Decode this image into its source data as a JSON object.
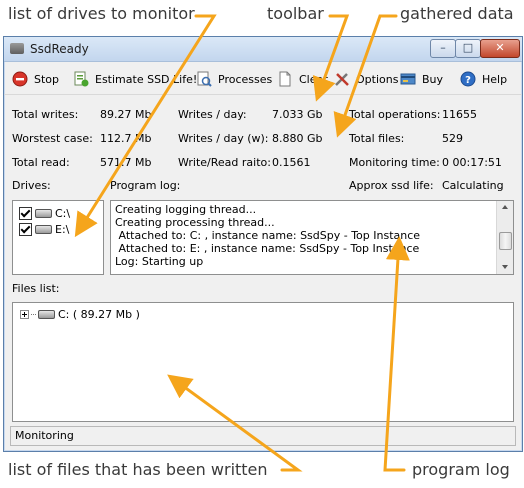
{
  "annotations": {
    "drives_monitor": "list of drives to monitor",
    "toolbar": "toolbar",
    "gathered_data": "gathered data",
    "files_written": "list of files that has been written",
    "program_log": "program log"
  },
  "window": {
    "title": "SsdReady"
  },
  "toolbar": {
    "stop": "Stop",
    "estimate": "Estimate SSD Life!",
    "processes": "Processes",
    "clear": "Clear",
    "options": "Options",
    "buy": "Buy",
    "help": "Help"
  },
  "stats": {
    "total_writes_label": "Total writes:",
    "total_writes_value": "89.27 Mb",
    "worst_case_label": "Worstest case:",
    "worst_case_value": "112.7 Mb",
    "total_read_label": "Total read:",
    "total_read_value": "571.7 Mb",
    "writes_day_label": "Writes / day:",
    "writes_day_value": "7.033 Gb",
    "writes_day_w_label": "Writes / day (w):",
    "writes_day_w_value": "8.880 Gb",
    "ratio_label": "Write/Read raito:",
    "ratio_value": "0.1561",
    "total_ops_label": "Total operations:",
    "total_ops_value": "11655",
    "total_files_label": "Total files:",
    "total_files_value": "529",
    "monitoring_time_label": "Monitoring time:",
    "monitoring_time_value": "0 00:17:51",
    "ssd_life_label": "Approx ssd life:",
    "ssd_life_value": "Calculating"
  },
  "drives": {
    "label": "Drives:",
    "items": [
      "C:\\",
      "E:\\"
    ]
  },
  "log": {
    "label": "Program log:",
    "lines": [
      "Creating logging thread...",
      "Creating processing thread...",
      " Attached to: C: , instance name: SsdSpy - Top Instance",
      " Attached to: E: , instance name: SsdSpy - Top Instance",
      "Log: Starting up"
    ]
  },
  "files": {
    "label": "Files list:",
    "items": [
      "C: ( 89.27 Mb )"
    ]
  },
  "status": "Monitoring"
}
